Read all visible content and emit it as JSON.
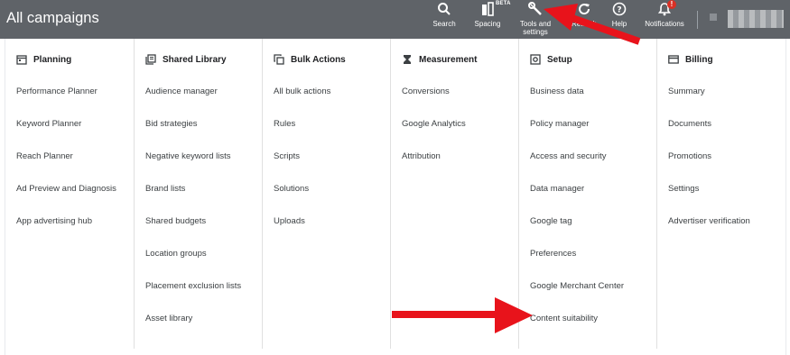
{
  "topbar": {
    "title": "All campaigns",
    "tools": [
      {
        "label": "Search",
        "icon": "search-icon"
      },
      {
        "label": "Spacing",
        "icon": "spacing-icon",
        "badge": "BETA"
      },
      {
        "label_line1": "Tools and",
        "label_line2": "settings",
        "icon": "wrench-icon"
      },
      {
        "label": "Refresh",
        "icon": "refresh-icon"
      },
      {
        "label": "Help",
        "icon": "help-icon"
      },
      {
        "label": "Notifications",
        "icon": "bell-icon",
        "count": "!"
      }
    ],
    "bar_color": "#5f6368"
  },
  "menu": {
    "columns": [
      {
        "heading": "Planning",
        "icon": "calendar-icon",
        "items": [
          "Performance Planner",
          "Keyword Planner",
          "Reach Planner",
          "Ad Preview and Diagnosis",
          "App advertising hub"
        ]
      },
      {
        "heading": "Shared Library",
        "icon": "library-icon",
        "items": [
          "Audience manager",
          "Bid strategies",
          "Negative keyword lists",
          "Brand lists",
          "Shared budgets",
          "Location groups",
          "Placement exclusion lists",
          "Asset library"
        ]
      },
      {
        "heading": "Bulk Actions",
        "icon": "copy-icon",
        "items": [
          "All bulk actions",
          "Rules",
          "Scripts",
          "Solutions",
          "Uploads"
        ]
      },
      {
        "heading": "Measurement",
        "icon": "hourglass-icon",
        "items": [
          "Conversions",
          "Google Analytics",
          "Attribution"
        ]
      },
      {
        "heading": "Setup",
        "icon": "setup-icon",
        "items": [
          "Business data",
          "Policy manager",
          "Access and security",
          "Data manager",
          "Google tag",
          "Preferences",
          "Google Merchant Center",
          "Content suitability"
        ]
      },
      {
        "heading": "Billing",
        "icon": "credit-card-icon",
        "items": [
          "Summary",
          "Documents",
          "Promotions",
          "Settings",
          "Advertiser verification"
        ]
      }
    ]
  },
  "annotation_color": "#e8131b"
}
